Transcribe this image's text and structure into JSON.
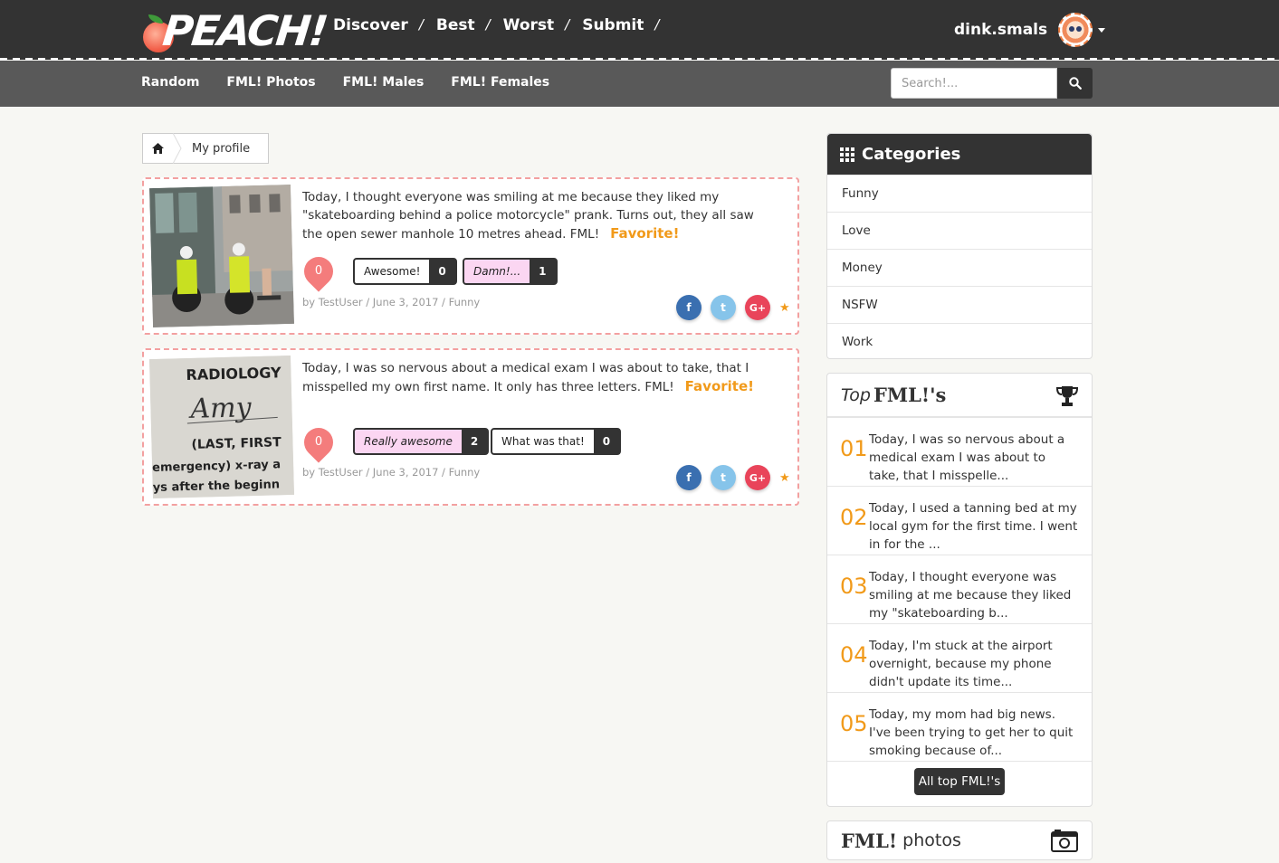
{
  "header": {
    "logo_text": "PEACH!",
    "nav": [
      "Discover",
      "Best",
      "Worst",
      "Submit"
    ],
    "nav_separator": "/",
    "username": "dink.smals"
  },
  "subnav": {
    "items": [
      "Random",
      "FML! Photos",
      "FML! Males",
      "FML! Females"
    ],
    "search_placeholder": "Search!..."
  },
  "breadcrumb": {
    "current": "My profile"
  },
  "posts": [
    {
      "text": "Today, I thought everyone was smiling at me because they liked my \"skateboarding behind a police motorcycle\" prank. Turns out, they all saw the open sewer manhole 10 metres ahead. FML!",
      "favorite_label": "Favorite!",
      "score": "0",
      "votes": [
        {
          "label": "Awesome!",
          "count": "0"
        },
        {
          "label": "Damn!...",
          "count": "1"
        }
      ],
      "meta": "by TestUser / June 3, 2017 / Funny"
    },
    {
      "text": "Today, I was so nervous about a medical exam I was about to take, that I misspelled my own first name. It only has three letters. FML!",
      "favorite_label": "Favorite!",
      "score": "0",
      "image_text": {
        "l1": "RADIOLOGY",
        "l2": "Amy",
        "l3": "(LAST, FIRST",
        "l4": "emergency) x-ray a",
        "l5": "ys after  the beginn"
      },
      "votes": [
        {
          "label": "Really awesome",
          "count": "2"
        },
        {
          "label": "What was that!",
          "count": "0"
        }
      ],
      "meta": "by TestUser / June 3, 2017 / Funny"
    }
  ],
  "share": {
    "fb": "f",
    "tw": "t",
    "gp": "G+"
  },
  "categories": {
    "title": "Categories",
    "items": [
      "Funny",
      "Love",
      "Money",
      "NSFW",
      "Work"
    ]
  },
  "top": {
    "title_italic": "Top",
    "title_bold": "FML!'s",
    "items": [
      {
        "num": "01",
        "text": "Today, I was so nervous about a medical exam I was about to take, that I misspelle..."
      },
      {
        "num": "02",
        "text": "Today, I used a tanning bed at my local gym for the first time. I went in for the ..."
      },
      {
        "num": "03",
        "text": "Today, I thought everyone was smiling at me because they liked my \"skateboarding b..."
      },
      {
        "num": "04",
        "text": "Today, I'm stuck at the airport overnight, because my phone didn't update its time..."
      },
      {
        "num": "05",
        "text": "Today, my mom had big news. I've been trying to get her to quit smoking because of..."
      }
    ],
    "button": "All top FML!'s"
  },
  "photos": {
    "title_bold": "FML!",
    "title_rest": "photos"
  },
  "colors": {
    "accent": "#f19a1a",
    "dark": "#333333",
    "post_border": "#f3a0a0",
    "score_badge": "#f47c7c",
    "vote_active": "#fbd6f2"
  }
}
